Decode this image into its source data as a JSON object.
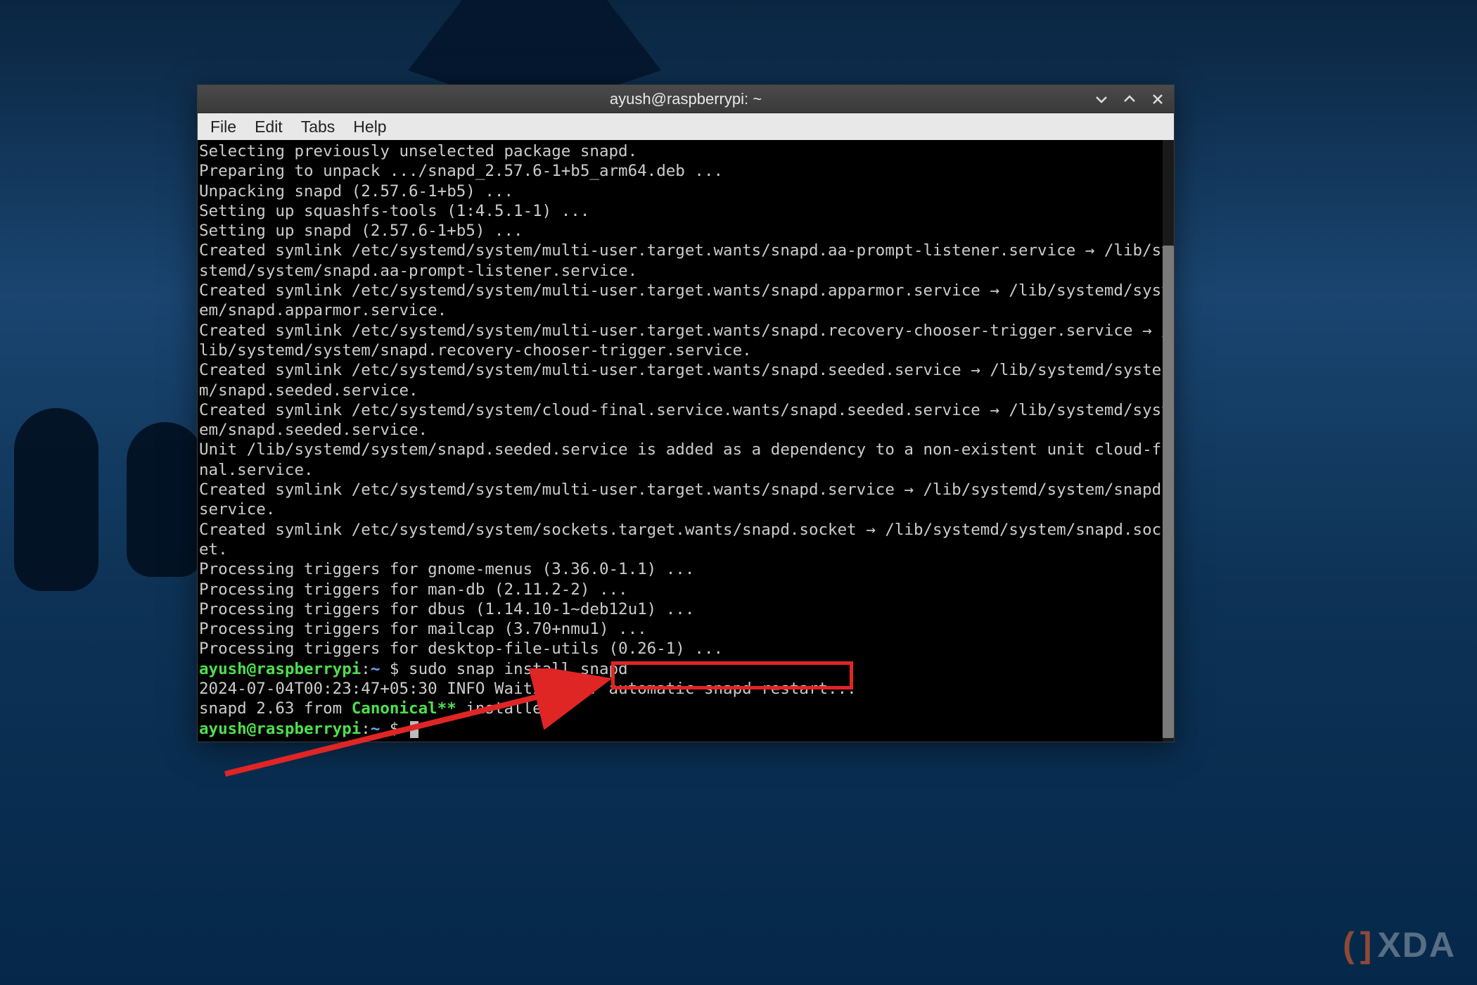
{
  "window": {
    "title": "ayush@raspberrypi: ~"
  },
  "menubar": {
    "file": "File",
    "edit": "Edit",
    "tabs": "Tabs",
    "help": "Help"
  },
  "terminal": {
    "lines": [
      "Selecting previously unselected package snapd.",
      "Preparing to unpack .../snapd_2.57.6-1+b5_arm64.deb ...",
      "Unpacking snapd (2.57.6-1+b5) ...",
      "Setting up squashfs-tools (1:4.5.1-1) ...",
      "Setting up snapd (2.57.6-1+b5) ...",
      "Created symlink /etc/systemd/system/multi-user.target.wants/snapd.aa-prompt-listener.service → /lib/systemd/system/snapd.aa-prompt-listener.service.",
      "Created symlink /etc/systemd/system/multi-user.target.wants/snapd.apparmor.service → /lib/systemd/system/snapd.apparmor.service.",
      "Created symlink /etc/systemd/system/multi-user.target.wants/snapd.recovery-chooser-trigger.service → /lib/systemd/system/snapd.recovery-chooser-trigger.service.",
      "Created symlink /etc/systemd/system/multi-user.target.wants/snapd.seeded.service → /lib/systemd/system/snapd.seeded.service.",
      "Created symlink /etc/systemd/system/cloud-final.service.wants/snapd.seeded.service → /lib/systemd/system/snapd.seeded.service.",
      "Unit /lib/systemd/system/snapd.seeded.service is added as a dependency to a non-existent unit cloud-final.service.",
      "Created symlink /etc/systemd/system/multi-user.target.wants/snapd.service → /lib/systemd/system/snapd.service.",
      "Created symlink /etc/systemd/system/sockets.target.wants/snapd.socket → /lib/systemd/system/snapd.socket.",
      "Processing triggers for gnome-menus (3.36.0-1.1) ...",
      "Processing triggers for man-db (2.11.2-2) ...",
      "Processing triggers for dbus (1.14.10-1~deb12u1) ...",
      "Processing triggers for mailcap (3.70+nmu1) ...",
      "Processing triggers for desktop-file-utils (0.26-1) ..."
    ],
    "prompt1": {
      "user": "ayush@raspberrypi",
      "sep": ":",
      "path": "~",
      "dollar": " $ ",
      "command": "sudo snap install snapd"
    },
    "after_cmd": "2024-07-04T00:23:47+05:30 INFO Waiting for automatic snapd restart...",
    "installed_line": {
      "pre": "snapd 2.63 from ",
      "pub": "Canonical**",
      "post": " installed"
    },
    "prompt2": {
      "user": "ayush@raspberrypi",
      "sep": ":",
      "path": "~",
      "dollar": " $ "
    }
  },
  "watermark": {
    "text": "XDA"
  },
  "annotation": {
    "command_box": "sudo snap install snapd"
  }
}
